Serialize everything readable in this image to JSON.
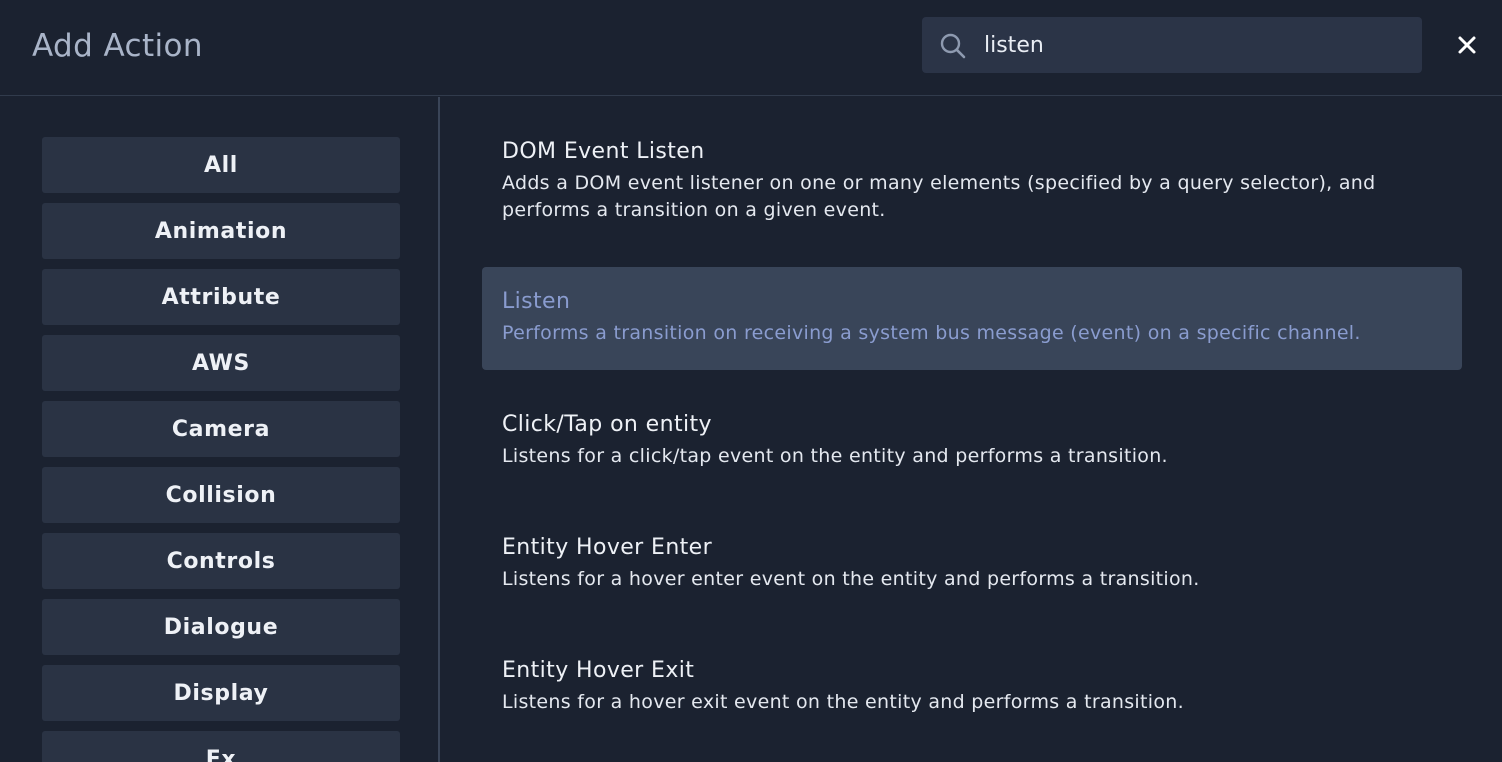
{
  "header": {
    "title": "Add Action",
    "close_icon": "close-icon"
  },
  "search": {
    "value": "listen",
    "icon": "search-icon"
  },
  "categories": [
    "All",
    "Animation",
    "Attribute",
    "AWS",
    "Camera",
    "Collision",
    "Controls",
    "Dialogue",
    "Display",
    "Fx"
  ],
  "actions": [
    {
      "name": "DOM Event Listen",
      "description": "Adds a DOM event listener on one or many elements (specified by a query selector), and performs a transition on a given event."
    },
    {
      "name": "Listen",
      "description": "Performs a transition on receiving a system bus message (event) on a specific channel.",
      "selected": true
    },
    {
      "name": "Click/Tap on entity",
      "description": "Listens for a click/tap event on the entity and performs a transition."
    },
    {
      "name": "Entity Hover Enter",
      "description": "Listens for a hover enter event on the entity and performs a transition."
    },
    {
      "name": "Entity Hover Exit",
      "description": "Listens for a hover exit event on the entity and performs a transition."
    }
  ],
  "colors": {
    "background": "#1b2230",
    "button": "#2a3344",
    "selected": "#394559",
    "selected_text": "#8a9ccf"
  }
}
